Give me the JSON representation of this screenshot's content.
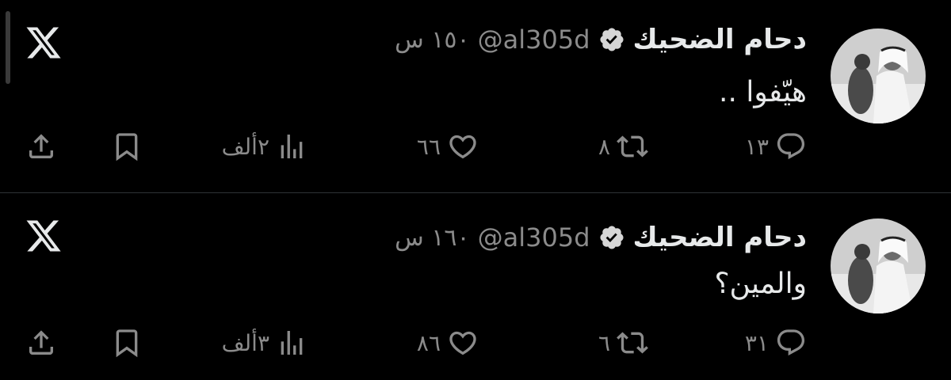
{
  "tweets": [
    {
      "display_name": "دحام الضحيك",
      "handle": "@al305d",
      "time": "١٥٠ س",
      "text": "هيّفوا ..",
      "replies": "١٣",
      "retweets": "٨",
      "likes": "٦٦",
      "views": "٢ألف"
    },
    {
      "display_name": "دحام الضحيك",
      "handle": "@al305d",
      "time": "١٦٠ س",
      "text": "والمين؟",
      "replies": "٣١",
      "retweets": "٦",
      "likes": "٨٦",
      "views": "٣ألف"
    }
  ],
  "icons": {
    "avatar": "avatar-image",
    "verified": "verified-badge-icon",
    "logo": "x-logo-icon",
    "reply": "reply-icon",
    "retweet": "retweet-icon",
    "like": "heart-icon",
    "views": "views-icon",
    "bookmark": "bookmark-icon",
    "share": "share-icon"
  },
  "colors": {
    "background": "#000000",
    "text": "#e7e9ea",
    "muted": "#8b8b8b",
    "divider": "#2f3336"
  }
}
